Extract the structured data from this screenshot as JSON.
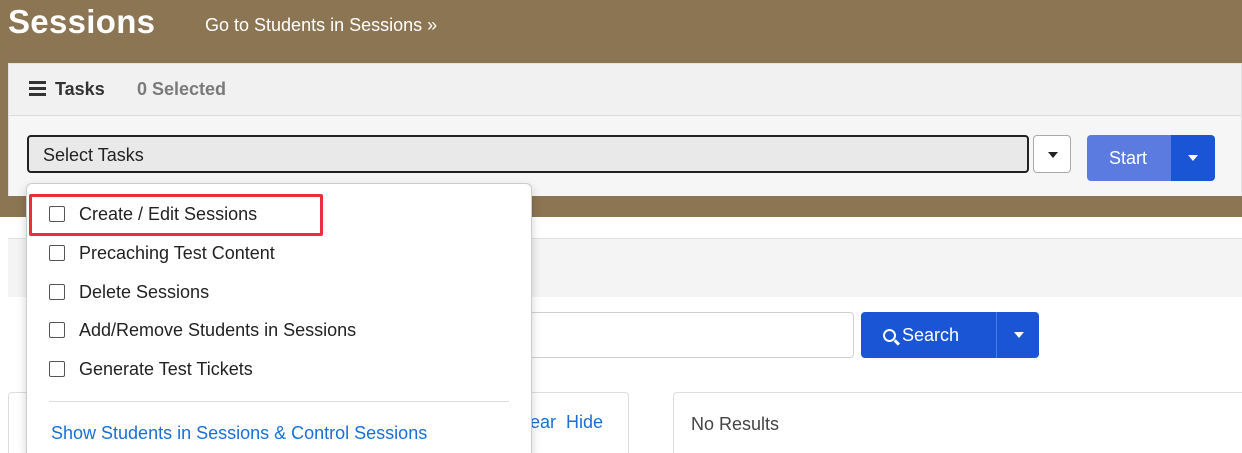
{
  "header": {
    "title": "Sessions",
    "go_link": "Go to Students in Sessions »"
  },
  "tasks": {
    "title": "Tasks",
    "selected_count": "0 Selected",
    "select_value": "Select Tasks",
    "start_label": "Start"
  },
  "dropdown": {
    "items": [
      {
        "label": "Create / Edit Sessions"
      },
      {
        "label": "Precaching Test Content"
      },
      {
        "label": "Delete Sessions"
      },
      {
        "label": "Add/Remove Students in Sessions"
      },
      {
        "label": "Generate Test Tickets"
      }
    ],
    "link_label": "Show Students in Sessions & Control Sessions"
  },
  "search": {
    "button_label": "Search"
  },
  "results": {
    "clear_fragment": "ear",
    "hide_label": "Hide",
    "no_results": "No Results"
  },
  "colors": {
    "header_brown": "#8b7553",
    "primary_blue": "#1a55d6",
    "start_blue": "#5b7be0",
    "highlight_red": "#e8303a",
    "link_blue": "#1a6fd6"
  },
  "icons": {
    "tasks": "tasks-list-icon",
    "search": "search-icon",
    "caret": "chevron-down-icon"
  }
}
